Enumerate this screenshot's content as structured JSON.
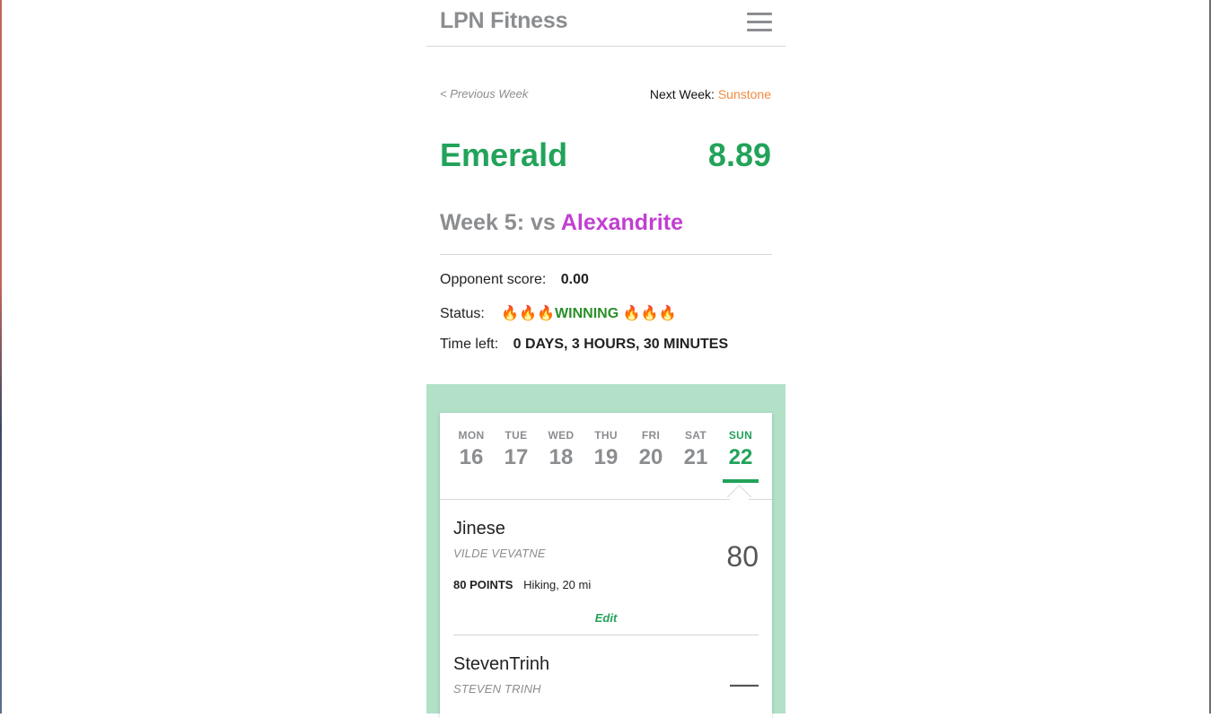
{
  "header": {
    "brand": "LPN Fitness"
  },
  "week_nav": {
    "prev_label": "< Previous Week",
    "next_prefix": "Next Week:",
    "next_team": "Sunstone"
  },
  "team": {
    "name": "Emerald",
    "score": "8.89"
  },
  "matchup": {
    "week_label": "Week 5: vs",
    "opponent": "Alexandrite"
  },
  "info": {
    "opp_score_label": "Opponent score:",
    "opp_score_value": "0.00",
    "status_label": "Status:",
    "status_fire_left": "🔥🔥🔥",
    "status_value": "WINNING",
    "status_fire_right": "🔥🔥🔥",
    "time_label": "Time left:",
    "time_value": "0 DAYS, 3 HOURS, 30 MINUTES"
  },
  "days": [
    {
      "dow": "MON",
      "dom": "16",
      "active": false
    },
    {
      "dow": "TUE",
      "dom": "17",
      "active": false
    },
    {
      "dow": "WED",
      "dom": "18",
      "active": false
    },
    {
      "dow": "THU",
      "dom": "19",
      "active": false
    },
    {
      "dow": "FRI",
      "dom": "20",
      "active": false
    },
    {
      "dow": "SAT",
      "dom": "21",
      "active": false
    },
    {
      "dow": "SUN",
      "dom": "22",
      "active": true
    }
  ],
  "entries": [
    {
      "name": "Jinese",
      "real_name": "VILDE VEVATNE",
      "points": "80",
      "points_label": "80 POINTS",
      "activity": "Hiking, 20 mi",
      "edit_label": "Edit"
    },
    {
      "name": "StevenTrinh",
      "real_name": "STEVEN TRINH",
      "points": "—"
    }
  ],
  "colors": {
    "accent_green": "#22a35a",
    "opponent_purple": "#c13fd1",
    "next_orange": "#f08a3e",
    "panel_green": "#b2e1c8"
  }
}
